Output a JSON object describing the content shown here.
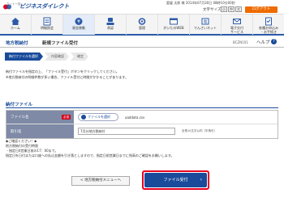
{
  "header": {
    "logo_sub": "ネット一括",
    "logo_text": "ビジネスダイレクト",
    "user_name": "愛媛 太郎 様",
    "last_login": "2014年07月30日 08時10分00秒",
    "font_size_label": "文字サイズ",
    "font_small": "小",
    "font_medium": "中",
    "font_large": "大",
    "logout_label": "ログアウト"
  },
  "nav": [
    {
      "label": "ホーム",
      "icon": "home-icon"
    },
    {
      "label": "明細照会",
      "icon": "statement-icon"
    },
    {
      "label": "資金移動",
      "icon": "transfer-icon"
    },
    {
      "label": "承認",
      "icon": "approve-icon"
    },
    {
      "label": "管理",
      "icon": "manage-icon"
    },
    {
      "label": "がいたのWEB",
      "icon": "web-icon"
    },
    {
      "label": "でんさいネット",
      "icon": "densai-icon"
    },
    {
      "label": "電子交付",
      "label2": "サービス",
      "icon": "e-delivery-icon"
    },
    {
      "label": "各種お申込み",
      "label2": "・お手続き",
      "icon": "application-icon"
    }
  ],
  "page": {
    "title_main": "地方税納付",
    "title_sub": "新規ファイル受付",
    "screen_id": "BCZN101",
    "help_label": "ヘルプ"
  },
  "steps": [
    "納付ファイルを選択",
    "内容確認",
    "確定"
  ],
  "info_lines": [
    "納付ファイルを指定の上、「ファイル受付」ボタンをクリックしてください。",
    "※地方税納付の明細件数が多い場合、ファイル受付に時間がかかることがあります。"
  ],
  "section_title": "納付ファイル",
  "form": {
    "file_label": "ファイル名",
    "required_label": "必須",
    "file_button_label": "ファイルを選択",
    "file_name": "aaddata.csv",
    "name_label": "取引名",
    "name_value": "7月分地方税納付",
    "name_hint": "全角10文字以内［半角可］"
  },
  "notes": [
    "◆ご確認ください！◆",
    "地方税納付の受付時限",
    "・指定日4営業日前の17：00まで。",
    "指定日を日付または口座への払込金額を引き落としますので、指定日前営業日までに残高のご確認をお願いします。"
  ],
  "buttons": {
    "back_label": "< 地方税納付メニューへ",
    "submit_label": "ファイル受付"
  },
  "colors": {
    "brand_blue": "#1a4b9b",
    "logout_orange": "#ee6b00",
    "highlight_red": "#e6001f"
  }
}
